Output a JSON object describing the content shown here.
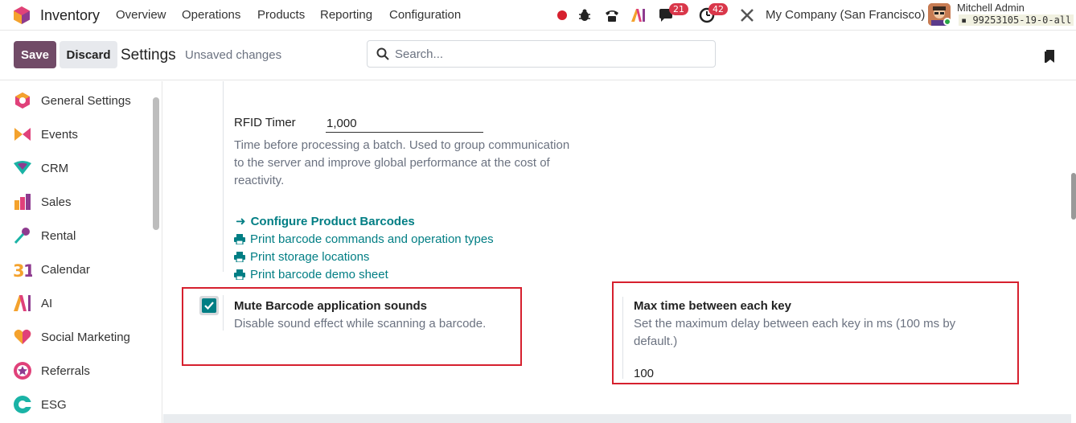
{
  "topnav": {
    "app_name": "Inventory",
    "menu": [
      "Overview",
      "Operations",
      "Products",
      "Reporting",
      "Configuration"
    ],
    "messages_badge": "21",
    "activities_badge": "42",
    "company": "My Company (San Francisco)",
    "user_name": "Mitchell Admin",
    "database": "99253105-19-0-all"
  },
  "controlbar": {
    "save_label": "Save",
    "discard_label": "Discard",
    "title": "Settings",
    "status": "Unsaved changes",
    "search_placeholder": "Search..."
  },
  "sidebar": {
    "items": [
      {
        "label": "General Settings",
        "icon": "general-settings-icon"
      },
      {
        "label": "Events",
        "icon": "events-icon"
      },
      {
        "label": "CRM",
        "icon": "crm-icon"
      },
      {
        "label": "Sales",
        "icon": "sales-icon"
      },
      {
        "label": "Rental",
        "icon": "rental-icon"
      },
      {
        "label": "Calendar",
        "icon": "calendar-icon"
      },
      {
        "label": "AI",
        "icon": "ai-icon"
      },
      {
        "label": "Social Marketing",
        "icon": "social-marketing-icon"
      },
      {
        "label": "Referrals",
        "icon": "referrals-icon"
      },
      {
        "label": "ESG",
        "icon": "esg-icon"
      }
    ]
  },
  "settings": {
    "rfid_timer_label": "RFID Timer",
    "rfid_timer_value": "1,000",
    "rfid_timer_desc": "Time before processing a batch. Used to group communication to the server and improve global performance at the cost of reactivity.",
    "links": [
      "Configure Product Barcodes",
      "Print barcode commands and operation types",
      "Print storage locations",
      "Print barcode demo sheet"
    ],
    "mute_title": "Mute Barcode application sounds",
    "mute_desc": "Disable sound effect while scanning a barcode.",
    "mute_checked": true,
    "max_time_title": "Max time between each key",
    "max_time_desc": "Set the maximum delay between each key in ms (100 ms by default.)",
    "max_time_value": "100"
  },
  "colors": {
    "brand": "#714b67",
    "link": "#017e84",
    "highlight_box": "#d6202e",
    "badge": "#d9374a"
  }
}
